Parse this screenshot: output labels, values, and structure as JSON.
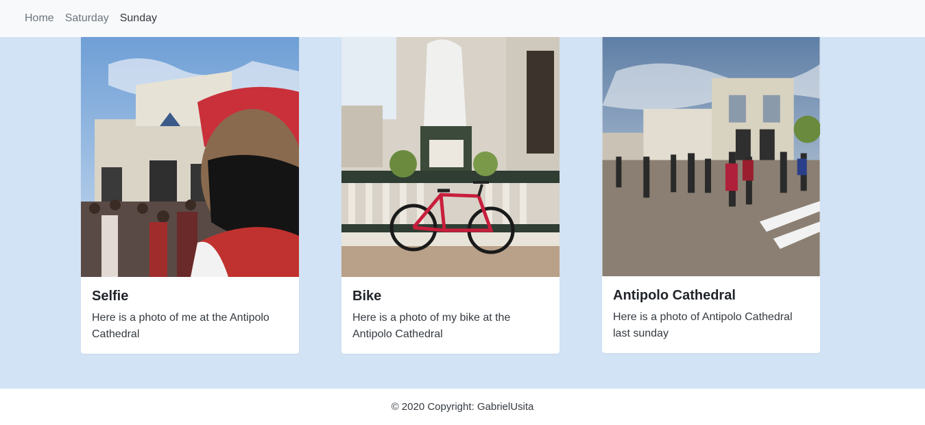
{
  "nav": {
    "items": [
      {
        "label": "Home"
      },
      {
        "label": "Saturday"
      },
      {
        "label": "Sunday"
      }
    ]
  },
  "cards": [
    {
      "title": "Selfie",
      "text": "Here is a photo of me at the Antipolo Cathedral"
    },
    {
      "title": "Bike",
      "text": "Here is a photo of my bike at the Antipolo Cathedral"
    },
    {
      "title": "Antipolo Cathedral",
      "text": "Here is a photo of Antipolo Cathedral last sunday"
    }
  ],
  "footer": {
    "copyright": "© 2020 Copyright: GabrielUsita"
  },
  "colors": {
    "page_bg": "#d2e3f5",
    "nav_bg": "#f8f9fa",
    "card_bg": "#ffffff"
  }
}
